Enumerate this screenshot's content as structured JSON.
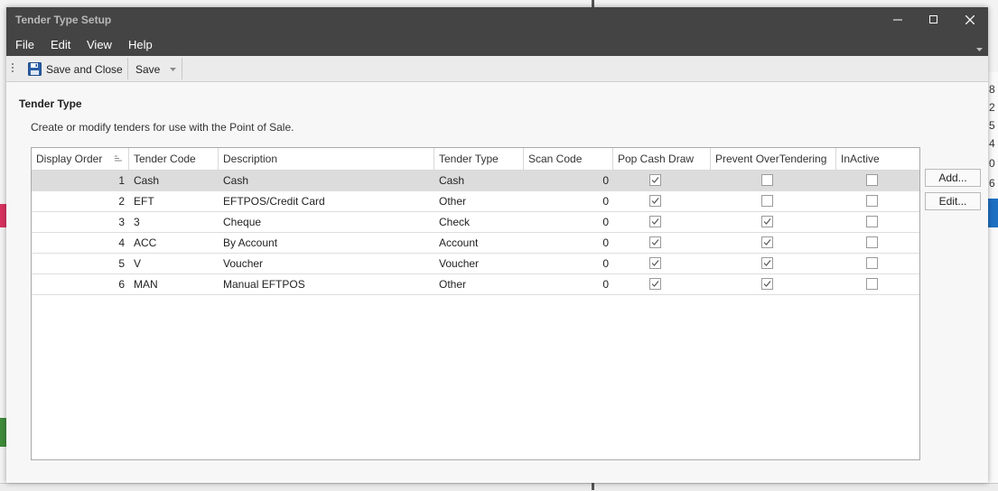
{
  "window": {
    "title": "Tender Type Setup"
  },
  "menu": {
    "items": [
      "File",
      "Edit",
      "View",
      "Help"
    ]
  },
  "toolbar": {
    "save_close_label": "Save and Close",
    "save_label": "Save"
  },
  "section": {
    "title": "Tender Type",
    "description": "Create or modify tenders for use with the Point of Sale."
  },
  "table": {
    "columns": [
      "Display Order",
      "Tender Code",
      "Description",
      "Tender Type",
      "Scan Code",
      "Pop Cash Draw",
      "Prevent OverTendering",
      "InActive"
    ],
    "rows": [
      {
        "order": "1",
        "code": "Cash",
        "description": "Cash",
        "type": "Cash",
        "scan": "0",
        "pop": true,
        "prevent": false,
        "inactive": false
      },
      {
        "order": "2",
        "code": "EFT",
        "description": "EFTPOS/Credit Card",
        "type": "Other",
        "scan": "0",
        "pop": true,
        "prevent": false,
        "inactive": false
      },
      {
        "order": "3",
        "code": "3",
        "description": "Cheque",
        "type": "Check",
        "scan": "0",
        "pop": true,
        "prevent": true,
        "inactive": false
      },
      {
        "order": "4",
        "code": "ACC",
        "description": "By Account",
        "type": "Account",
        "scan": "0",
        "pop": true,
        "prevent": true,
        "inactive": false
      },
      {
        "order": "5",
        "code": "V",
        "description": "Voucher",
        "type": "Voucher",
        "scan": "0",
        "pop": true,
        "prevent": true,
        "inactive": false
      },
      {
        "order": "6",
        "code": "MAN",
        "description": "Manual EFTPOS",
        "type": "Other",
        "scan": "0",
        "pop": true,
        "prevent": true,
        "inactive": false
      }
    ]
  },
  "actions": {
    "add_label": "Add...",
    "edit_label": "Edit..."
  },
  "background": {
    "right_glyphs": [
      "8",
      "2",
      "5",
      "4",
      "0",
      "6"
    ]
  },
  "colors": {
    "titlebar": "#444444",
    "toolbar": "#ebebeb",
    "selected_row": "#dcdcdc",
    "save_icon": "#2a5ea8"
  }
}
